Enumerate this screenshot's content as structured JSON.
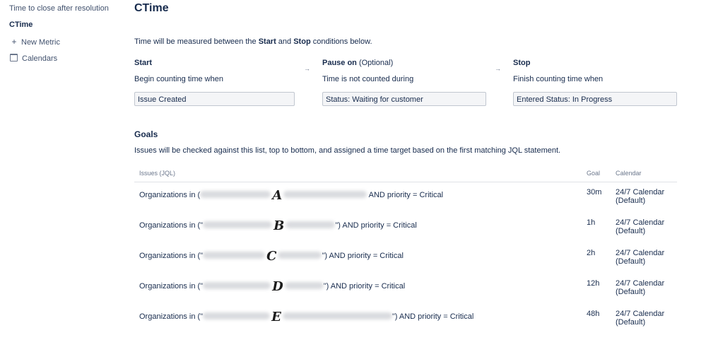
{
  "sidebar": {
    "items": [
      {
        "label": "Time to close after resolution",
        "icon": null
      },
      {
        "label": "CTime",
        "icon": null
      },
      {
        "label": "New Metric",
        "icon": "plus-icon"
      },
      {
        "label": "Calendars",
        "icon": "calendar-icon"
      }
    ]
  },
  "main": {
    "title": "CTime",
    "intro": {
      "prefix": "Time will be measured between the ",
      "start": "Start",
      "and": " and ",
      "stop": "Stop",
      "suffix": " conditions below."
    },
    "conditions": {
      "start": {
        "heading": "Start",
        "subheading": "Begin counting time when",
        "value": "Issue Created"
      },
      "pause": {
        "heading": "Pause on",
        "optional": " (Optional)",
        "subheading": "Time is not counted during",
        "value": "Status: Waiting for customer"
      },
      "stop": {
        "heading": "Stop",
        "subheading": "Finish counting time when",
        "value": "Entered Status: In Progress"
      },
      "arrow_glyph": "→"
    },
    "goals": {
      "title": "Goals",
      "description": "Issues will be checked against this list, top to bottom, and assigned a time target based on the first matching JQL statement.",
      "columns": {
        "issues": "Issues",
        "issues_sub": "(JQL)",
        "goal": "Goal",
        "calendar": "Calendar"
      },
      "rows": [
        {
          "prefix": "Organizations in (",
          "mark": "A",
          "suffix": " AND priority = Critical",
          "goal": "30m",
          "calendar": "24/7 Calendar (Default)"
        },
        {
          "prefix": "Organizations in (\"",
          "mark": "B",
          "suffix": "\") AND priority = Critical",
          "goal": "1h",
          "calendar": "24/7 Calendar (Default)"
        },
        {
          "prefix": "Organizations in (\"",
          "mark": "C",
          "suffix": "\") AND priority = Critical",
          "goal": "2h",
          "calendar": "24/7 Calendar (Default)"
        },
        {
          "prefix": "Organizations in (\"",
          "mark": "D",
          "suffix": "\") AND priority = Critical",
          "goal": "12h",
          "calendar": "24/7 Calendar (Default)"
        },
        {
          "prefix": "Organizations in (\"",
          "mark": "E",
          "suffix": "\") AND priority = Critical",
          "goal": "48h",
          "calendar": "24/7 Calendar (Default)"
        }
      ]
    }
  },
  "colors": {
    "text": "#172b4d",
    "muted": "#6b778c",
    "field_bg": "#f4f5f7",
    "border": "#dfe1e6"
  }
}
